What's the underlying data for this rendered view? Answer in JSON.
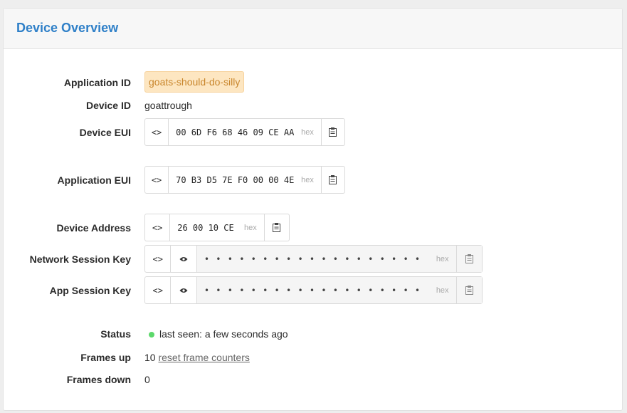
{
  "header": {
    "title": "Device Overview"
  },
  "fields": {
    "application_id": {
      "label": "Application ID",
      "value": "goats-should-do-silly"
    },
    "device_id": {
      "label": "Device ID",
      "value": "goattrough"
    },
    "device_eui": {
      "label": "Device EUI",
      "value": "00 6D F6 68 46 09 CE AA",
      "format": "hex"
    },
    "application_eui": {
      "label": "Application EUI",
      "value": "70 B3 D5 7E F0 00 00 4E",
      "format": "hex"
    },
    "device_address": {
      "label": "Device Address",
      "value": "26 00 10 CE",
      "format": "hex"
    },
    "network_session_key": {
      "label": "Network Session Key",
      "value": "• • • • • • • • • • • • • • • • • • • • • • • • • • • • • • • •",
      "format": "hex"
    },
    "app_session_key": {
      "label": "App Session Key",
      "value": "• • • • • • • • • • • • • • • • • • • • • • • • • • • • • • • •",
      "format": "hex"
    },
    "status": {
      "label": "Status",
      "value": "last seen: a few seconds ago",
      "color": "#5cd86b"
    },
    "frames_up": {
      "label": "Frames up",
      "value": "10",
      "link": "reset frame counters"
    },
    "frames_down": {
      "label": "Frames down",
      "value": "0"
    }
  },
  "icons": {
    "toggle": "code-toggle-icon",
    "reveal": "eye-icon",
    "copy": "clipboard-icon"
  }
}
